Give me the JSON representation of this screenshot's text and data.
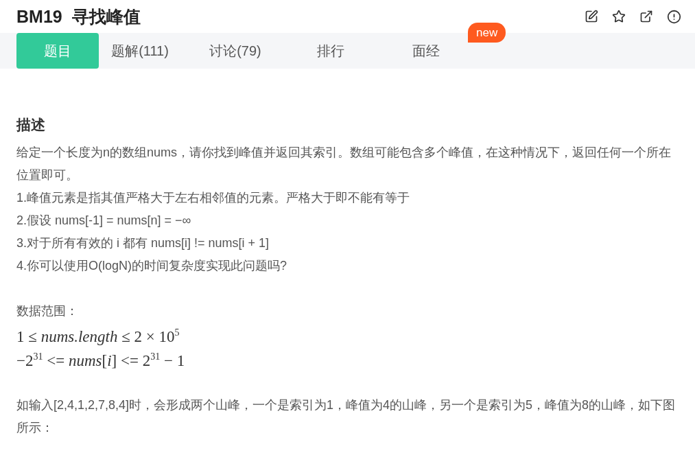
{
  "title": "BM19  寻找峰值",
  "tabs": [
    {
      "label": "题目",
      "selected": true
    },
    {
      "label": "题解(111)",
      "selected": false
    },
    {
      "label": "讨论(79)",
      "selected": false
    },
    {
      "label": "排行",
      "selected": false
    },
    {
      "label": "面经",
      "selected": false,
      "badge": "new"
    }
  ],
  "section": {
    "heading": "描述",
    "blocks": [
      {
        "kind": "text",
        "text": "给定一个长度为n的数组nums，请你找到峰值并返回其索引。数组可能包含多个峰值，在这种情况下，返回任何一个所在位置即可。"
      },
      {
        "kind": "text",
        "text": "1.峰值元素是指其值严格大于左右相邻值的元素。严格大于即不能有等于"
      },
      {
        "kind": "text",
        "text": "2.假设 nums[-1] = nums[n] = −∞"
      },
      {
        "kind": "text",
        "text": "3.对于所有有效的 i 都有 nums[i] != nums[i + 1]"
      },
      {
        "kind": "text",
        "text": "4.你可以使用O(logN)的时间复杂度实现此问题吗?"
      },
      {
        "kind": "gap"
      },
      {
        "kind": "text",
        "text": "数据范围："
      },
      {
        "kind": "math",
        "text": "1 ≤ *nums.length* ≤ 2 × 10$^{5}$"
      },
      {
        "kind": "math",
        "text": "−2$^{31}$ <= *nums*[*i*] <= 2$^{31}$ − 1"
      },
      {
        "kind": "gap"
      },
      {
        "kind": "text",
        "text": "如输入[2,4,1,2,7,8,4]时，会形成两个山峰，一个是索引为1，峰值为4的山峰，另一个是索引为5，峰值为8的山峰，如下图所示："
      }
    ]
  }
}
